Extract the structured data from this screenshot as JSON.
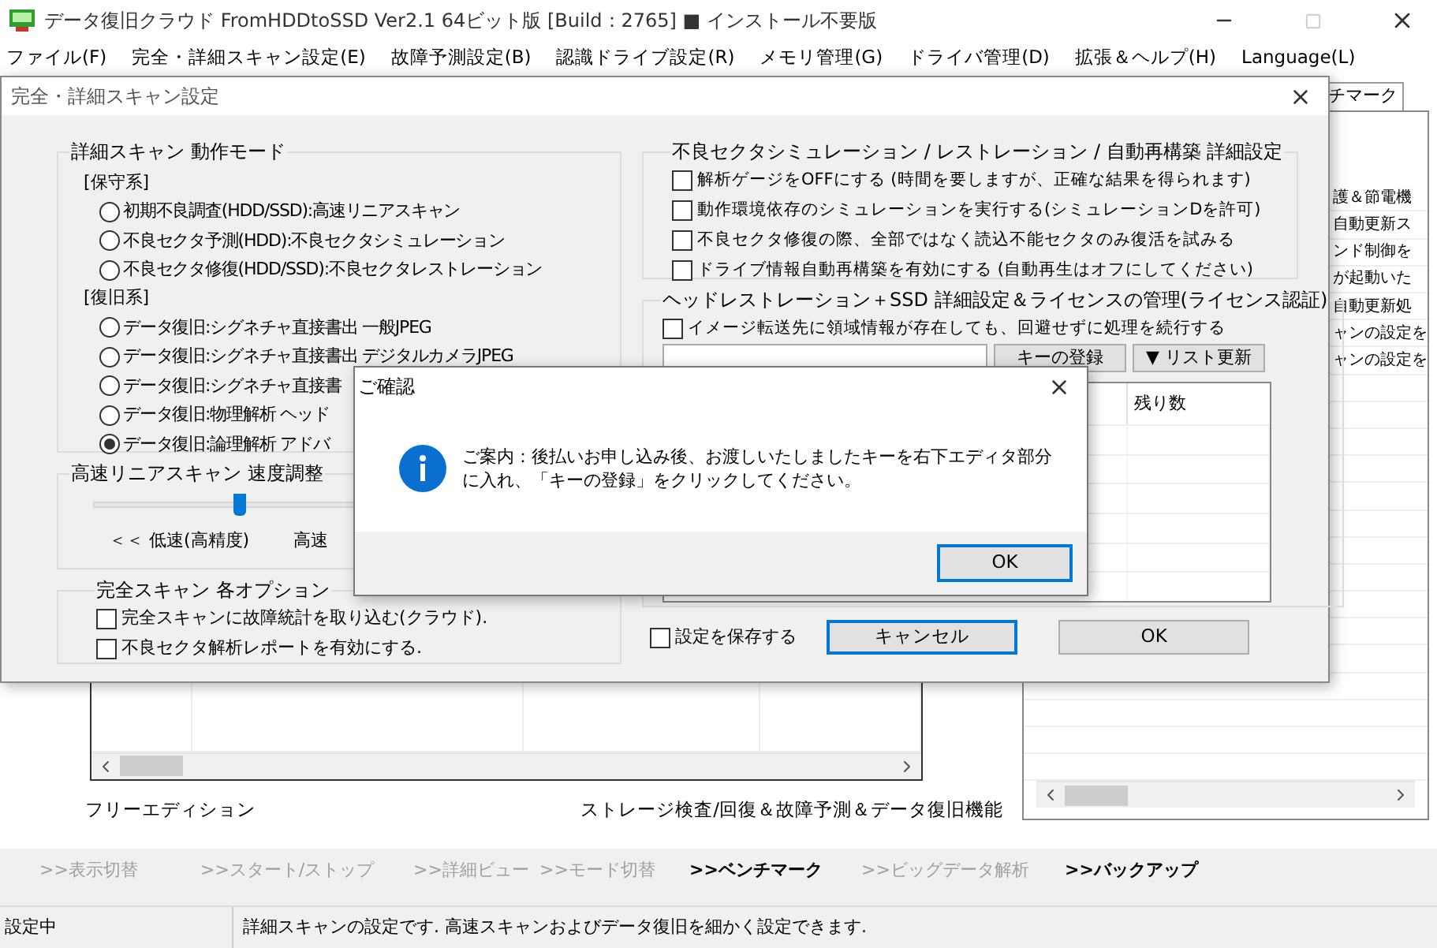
{
  "window": {
    "title": "データ復旧クラウド FromHDDtoSSD Ver2.1 64ビット版 [Build：2765] ■ インストール不要版"
  },
  "menu": [
    "ファイル(F)",
    "完全・詳細スキャン設定(E)",
    "故障予測設定(B)",
    "認識ドライブ設定(R)",
    "メモリ管理(G)",
    "ドライバ管理(D)",
    "拡張＆ヘルプ(H)",
    "Language(L)"
  ],
  "right_tab": {
    "label": "チマーク"
  },
  "right_panel": {
    "lines": [
      "護＆節電機",
      "自動更新ス",
      "ンド制御を",
      "が起動いた",
      "自動更新処",
      "ャンの設定を",
      "ャンの設定を"
    ]
  },
  "left_labels": {
    "edition": "フリーエディション",
    "feature": "ストレージ検査/回復＆故障予測＆データ復旧機能"
  },
  "nav_links": [
    {
      "label": ">>表示切替",
      "disabled": true
    },
    {
      "label": ">>スタート/ストップ",
      "disabled": true
    },
    {
      "label": ">>詳細ビュー",
      "disabled": true
    },
    {
      "label": ">>モード切替",
      "disabled": true
    },
    {
      "label": ">>ベンチマーク",
      "disabled": false
    },
    {
      "label": ">>ビッグデータ解析",
      "disabled": true
    },
    {
      "label": ">>バックアップ",
      "disabled": false
    }
  ],
  "status_bar": [
    "設定中",
    "詳細スキャンの設定です. 高速スキャンおよびデータ復旧を細かく設定できます."
  ],
  "settings_dialog": {
    "title": "完全・詳細スキャン設定",
    "mode_group": {
      "title": "詳細スキャン 動作モード",
      "items": [
        {
          "kind": "heading",
          "label": "[保守系]"
        },
        {
          "kind": "radio",
          "label": "初期不良調査(HDD/SSD):高速リニアスキャン",
          "selected": false
        },
        {
          "kind": "radio",
          "label": "不良セクタ予測(HDD):不良セクタシミュレーション",
          "selected": false
        },
        {
          "kind": "radio",
          "label": "不良セクタ修復(HDD/SSD):不良セクタレストレーション",
          "selected": false
        },
        {
          "kind": "heading",
          "label": "[復旧系]"
        },
        {
          "kind": "radio",
          "label": "データ復旧:シグネチャ直接書出 一般JPEG",
          "selected": false
        },
        {
          "kind": "radio",
          "label": "データ復旧:シグネチャ直接書出 デジタルカメラJPEG",
          "selected": false
        },
        {
          "kind": "radio",
          "label": "データ復旧:シグネチャ直接書",
          "selected": false
        },
        {
          "kind": "radio",
          "label": "データ復旧:物理解析 ヘッド",
          "selected": false
        },
        {
          "kind": "radio",
          "label": "データ復旧:論理解析 アドバ",
          "selected": true
        }
      ]
    },
    "speed_group": {
      "title": "高速リニアスキャン 速度調整",
      "level": 0.28,
      "labels": [
        "＜＜ 低速(高精度)",
        "高速"
      ]
    },
    "options_group": {
      "title": "完全スキャン 各オプション",
      "items": [
        {
          "label": "完全スキャンに故障統計を取り込む(クラウド).",
          "checked": false
        },
        {
          "label": "不良セクタ解析レポートを有効にする.",
          "checked": false
        }
      ]
    },
    "sim_group": {
      "title": "不良セクタシミュレーション / レストレーション / 自動再構築 詳細設定",
      "items": [
        {
          "label": "解析ゲージをOFFにする (時間を要しますが、正確な結果を得られます)",
          "checked": false
        },
        {
          "label": "動作環境依存のシミュレーションを実行する(シミュレーションDを許可)",
          "checked": false
        },
        {
          "label": "不良セクタ修復の際、全部ではなく読込不能セクタのみ復活を試みる",
          "checked": false
        },
        {
          "label": "ドライブ情報自動再構築を有効にする (自動再生はオフにしてください)",
          "checked": false
        }
      ]
    },
    "license_group": {
      "title": "ヘッドレストレーション＋SSD 詳細設定＆ライセンスの管理(ライセンス認証)",
      "option": {
        "label": "イメージ転送先に領域情報が存在しても、回避せずに処理を続行する",
        "checked": false
      },
      "buttons": [
        "キーの登録",
        "▼ リスト更新"
      ],
      "list_header": "残り数"
    },
    "save": {
      "label": "設定を保存する",
      "checked": false
    },
    "buttons": [
      {
        "label": "キャンセル",
        "focused": true
      },
      {
        "label": "OK",
        "focused": false
      }
    ]
  },
  "confirm_dialog": {
    "title": "ご確認",
    "message": "ご案内：後払いお申し込み後、お渡しいたしましたキーを右下エディタ部分に入れ、「キーの登録」をクリックしてください。",
    "button": {
      "label": "OK",
      "focused": true
    }
  }
}
